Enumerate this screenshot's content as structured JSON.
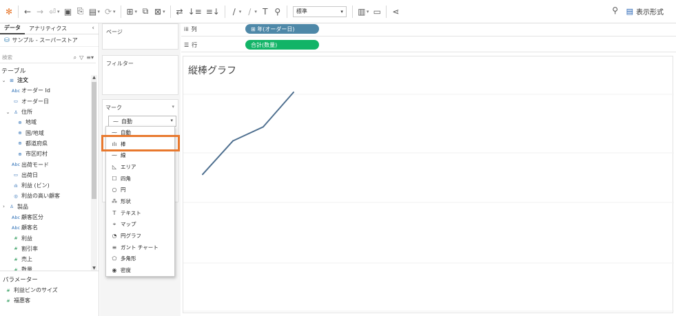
{
  "toolbar": {
    "fit_select": "標準",
    "show_me": "表示形式"
  },
  "data_pane": {
    "tab_data": "データ",
    "tab_analytics": "アナリティクス",
    "collapse": "‹",
    "data_source": "サンプル - スーパーストア",
    "search_placeholder": "検索",
    "tables_header": "テーブル",
    "fields": [
      {
        "label": "注文",
        "icon": "⊞",
        "caret": "⌄",
        "indent": 0,
        "bold": true,
        "measure": false
      },
      {
        "label": "オーダー Id",
        "icon": "Abc",
        "caret": "",
        "indent": 1,
        "bold": false,
        "measure": false
      },
      {
        "label": "オーダー日",
        "icon": "▭",
        "caret": "",
        "indent": 1,
        "bold": false,
        "measure": false
      },
      {
        "label": "住所",
        "icon": "♙",
        "caret": "⌄",
        "indent": 1,
        "bold": false,
        "measure": false
      },
      {
        "label": "地域",
        "icon": "⊕",
        "caret": "",
        "indent": 2,
        "bold": false,
        "measure": false
      },
      {
        "label": "国/地域",
        "icon": "⊕",
        "caret": "",
        "indent": 2,
        "bold": false,
        "measure": false
      },
      {
        "label": "都道府県",
        "icon": "⊕",
        "caret": "",
        "indent": 2,
        "bold": false,
        "measure": false
      },
      {
        "label": "市区町村",
        "icon": "⊕",
        "caret": "",
        "indent": 2,
        "bold": false,
        "measure": false
      },
      {
        "label": "出荷モード",
        "icon": "Abc",
        "caret": "",
        "indent": 1,
        "bold": false,
        "measure": false
      },
      {
        "label": "出荷日",
        "icon": "▭",
        "caret": "",
        "indent": 1,
        "bold": false,
        "measure": false
      },
      {
        "label": "利益 (ビン)",
        "icon": "ılı",
        "caret": "",
        "indent": 1,
        "bold": false,
        "measure": false
      },
      {
        "label": "利益の高い顧客",
        "icon": "◎",
        "caret": "",
        "indent": 1,
        "bold": false,
        "measure": false
      },
      {
        "label": "製品",
        "icon": "♙",
        "caret": "›",
        "indent": 0,
        "bold": false,
        "measure": false
      },
      {
        "label": "顧客区分",
        "icon": "Abc",
        "caret": "",
        "indent": 1,
        "bold": false,
        "measure": false
      },
      {
        "label": "顧客名",
        "icon": "Abc",
        "caret": "",
        "indent": 1,
        "bold": false,
        "measure": false
      },
      {
        "label": "利益",
        "icon": "#",
        "caret": "",
        "indent": 1,
        "bold": false,
        "measure": true
      },
      {
        "label": "割引率",
        "icon": "#",
        "caret": "",
        "indent": 1,
        "bold": false,
        "measure": true
      },
      {
        "label": "売上",
        "icon": "#",
        "caret": "",
        "indent": 1,
        "bold": false,
        "measure": true
      },
      {
        "label": "数量",
        "icon": "#",
        "caret": "",
        "indent": 1,
        "bold": false,
        "measure": true
      }
    ],
    "params_header": "パラメーター",
    "params": [
      {
        "label": "利益ビンのサイズ",
        "icon": "#"
      },
      {
        "label": "福惠客",
        "icon": "#"
      }
    ]
  },
  "shelves": {
    "pages": "ページ",
    "filters": "フィルター",
    "marks": "マーク",
    "marks_selected": "自動",
    "columns_label": "列",
    "columns_pill": "⊞ 年(オーダー日)",
    "rows_label": "行",
    "rows_pill": "合計(数量)"
  },
  "mark_options": [
    {
      "label": "自動",
      "icon": "⁓"
    },
    {
      "label": "棒",
      "icon": "ılı"
    },
    {
      "label": "線",
      "icon": "⁓"
    },
    {
      "label": "エリア",
      "icon": "◺"
    },
    {
      "label": "四角",
      "icon": "☐"
    },
    {
      "label": "円",
      "icon": "○"
    },
    {
      "label": "形状",
      "icon": "⁂"
    },
    {
      "label": "テキスト",
      "icon": "T"
    },
    {
      "label": "マップ",
      "icon": "⌖"
    },
    {
      "label": "円グラフ",
      "icon": "◔"
    },
    {
      "label": "ガント チャート",
      "icon": "≡"
    },
    {
      "label": "多角形",
      "icon": "⬠"
    },
    {
      "label": "密度",
      "icon": "◉"
    }
  ],
  "view": {
    "title": "縦棒グラフ"
  },
  "chart_data": {
    "type": "line",
    "title": "縦棒グラフ",
    "xlabel": "",
    "ylabel": "",
    "series": [
      {
        "values": [
          0.24,
          0.55,
          0.68,
          1.0
        ]
      }
    ],
    "colors": {
      "line": "#4e6f8f",
      "highlight": "#e8782d"
    }
  }
}
